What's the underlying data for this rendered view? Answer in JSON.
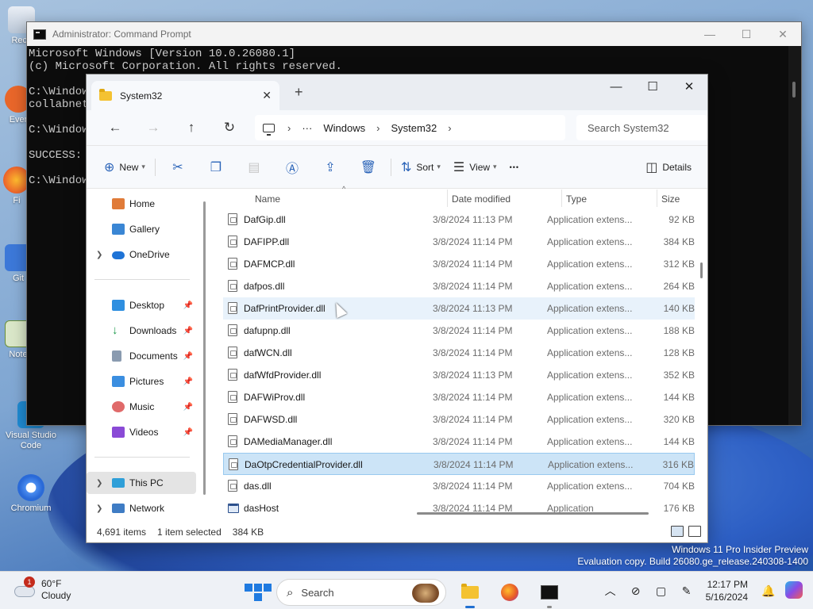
{
  "desktop": {
    "icons": [
      {
        "label": "Recy"
      },
      {
        "label": "Ever"
      },
      {
        "label": "Fi"
      },
      {
        "label": "Git"
      },
      {
        "label": "Note"
      },
      {
        "label": "Visual Studio Code"
      },
      {
        "label": "Chromium"
      }
    ],
    "watermark_line1": "Windows 11 Pro Insider Preview",
    "watermark_line2": "Evaluation copy. Build 26080.ge_release.240308-1400"
  },
  "cmd": {
    "title": "Administrator: Command Prompt",
    "lines": [
      "Microsoft Windows [Version 10.0.26080.1]",
      "(c) Microsoft Corporation. All rights reserved.",
      "",
      "C:\\Window",
      "collabnet",
      "",
      "C:\\Window",
      "",
      "SUCCESS: ",
      "",
      "C:\\Window"
    ]
  },
  "explorer": {
    "tab_title": "System32",
    "breadcrumb": [
      "Windows",
      "System32"
    ],
    "breadcrumb_overflow": "···",
    "search_placeholder": "Search System32",
    "toolbar": {
      "new": "New",
      "sort": "Sort",
      "view": "View",
      "more": "•••",
      "details": "Details"
    },
    "nav": {
      "home": "Home",
      "gallery": "Gallery",
      "onedrive": "OneDrive",
      "desktop": "Desktop",
      "downloads": "Downloads",
      "documents": "Documents",
      "pictures": "Pictures",
      "music": "Music",
      "videos": "Videos",
      "thispc": "This PC",
      "network": "Network"
    },
    "columns": {
      "name": "Name",
      "date": "Date modified",
      "type": "Type",
      "size": "Size"
    },
    "files": [
      {
        "name": "DafGip.dll",
        "date": "3/8/2024 11:13 PM",
        "type": "Application extens...",
        "size": "92 KB",
        "icon": "dll"
      },
      {
        "name": "DAFIPP.dll",
        "date": "3/8/2024 11:14 PM",
        "type": "Application extens...",
        "size": "384 KB",
        "icon": "dll"
      },
      {
        "name": "DAFMCP.dll",
        "date": "3/8/2024 11:14 PM",
        "type": "Application extens...",
        "size": "312 KB",
        "icon": "dll"
      },
      {
        "name": "dafpos.dll",
        "date": "3/8/2024 11:14 PM",
        "type": "Application extens...",
        "size": "264 KB",
        "icon": "dll"
      },
      {
        "name": "DafPrintProvider.dll",
        "date": "3/8/2024 11:13 PM",
        "type": "Application extens...",
        "size": "140 KB",
        "icon": "dll"
      },
      {
        "name": "dafupnp.dll",
        "date": "3/8/2024 11:14 PM",
        "type": "Application extens...",
        "size": "188 KB",
        "icon": "dll"
      },
      {
        "name": "dafWCN.dll",
        "date": "3/8/2024 11:14 PM",
        "type": "Application extens...",
        "size": "128 KB",
        "icon": "dll"
      },
      {
        "name": "dafWfdProvider.dll",
        "date": "3/8/2024 11:13 PM",
        "type": "Application extens...",
        "size": "352 KB",
        "icon": "dll"
      },
      {
        "name": "DAFWiProv.dll",
        "date": "3/8/2024 11:14 PM",
        "type": "Application extens...",
        "size": "144 KB",
        "icon": "dll"
      },
      {
        "name": "DAFWSD.dll",
        "date": "3/8/2024 11:14 PM",
        "type": "Application extens...",
        "size": "320 KB",
        "icon": "dll"
      },
      {
        "name": "DAMediaManager.dll",
        "date": "3/8/2024 11:14 PM",
        "type": "Application extens...",
        "size": "144 KB",
        "icon": "dll"
      },
      {
        "name": "DaOtpCredentialProvider.dll",
        "date": "3/8/2024 11:14 PM",
        "type": "Application extens...",
        "size": "316 KB",
        "icon": "dll"
      },
      {
        "name": "das.dll",
        "date": "3/8/2024 11:14 PM",
        "type": "Application extens...",
        "size": "704 KB",
        "icon": "dll"
      },
      {
        "name": "dasHost",
        "date": "3/8/2024 11:14 PM",
        "type": "Application",
        "size": "176 KB",
        "icon": "app"
      }
    ],
    "hovered_index": 4,
    "selected_index": 11,
    "status": {
      "items": "4,691 items",
      "selected": "1 item selected",
      "size": "384 KB"
    }
  },
  "taskbar": {
    "weather_temp": "60°F",
    "weather_desc": "Cloudy",
    "weather_badge": "1",
    "search_label": "Search",
    "time": "12:17 PM",
    "date": "5/16/2024"
  }
}
